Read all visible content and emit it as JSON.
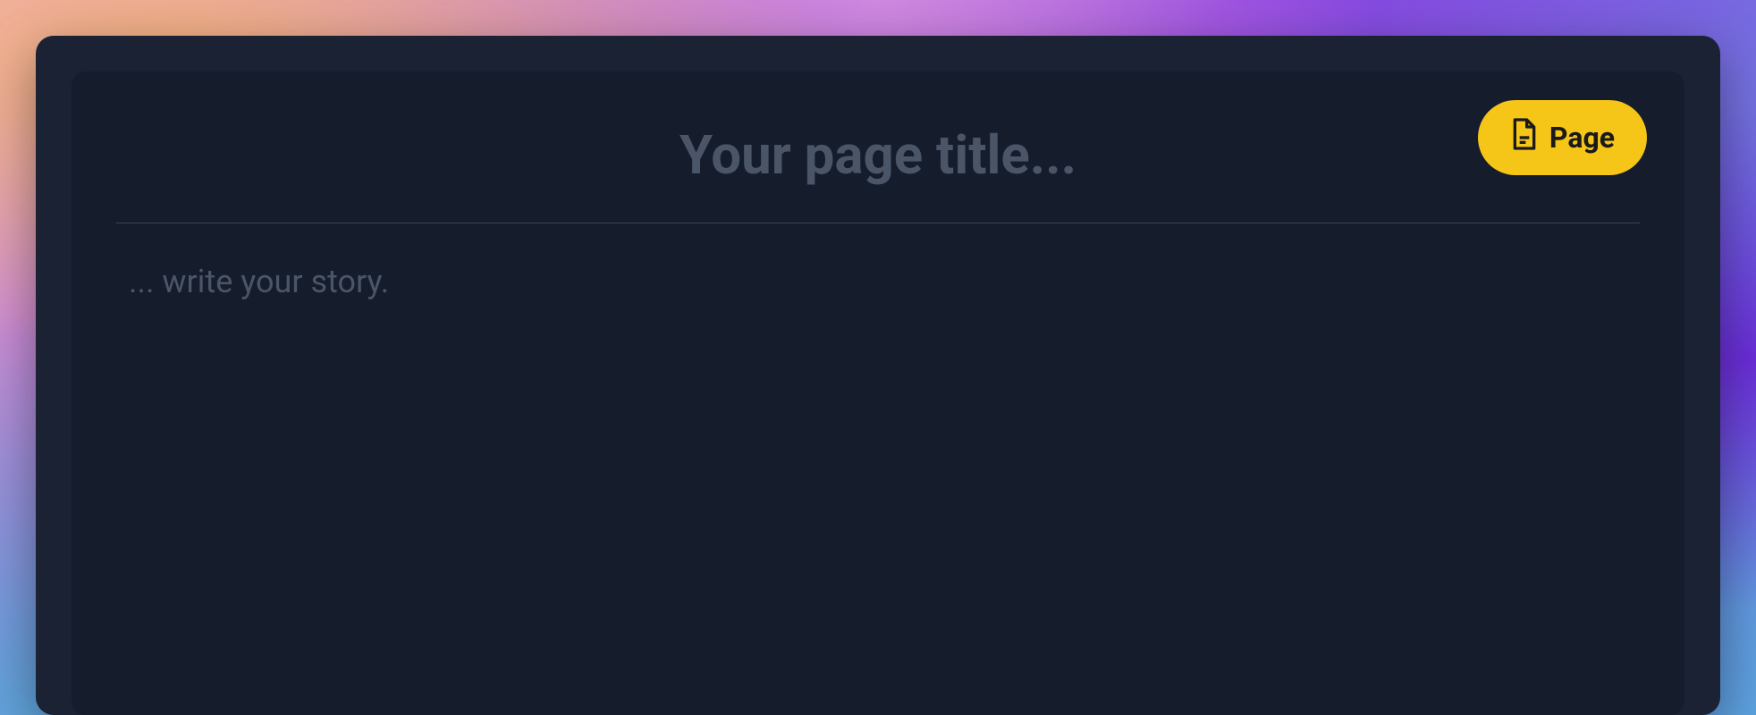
{
  "badge": {
    "label": "Page",
    "icon": "page-icon"
  },
  "editor": {
    "title_value": "",
    "title_placeholder": "Your page title...",
    "body_value": "",
    "body_placeholder": "... write your story."
  },
  "colors": {
    "badge_bg": "#f5c518",
    "panel_outer": "#1a2234",
    "panel_inner": "#151c2c",
    "placeholder": "#4a5568",
    "divider": "#3a4556"
  }
}
